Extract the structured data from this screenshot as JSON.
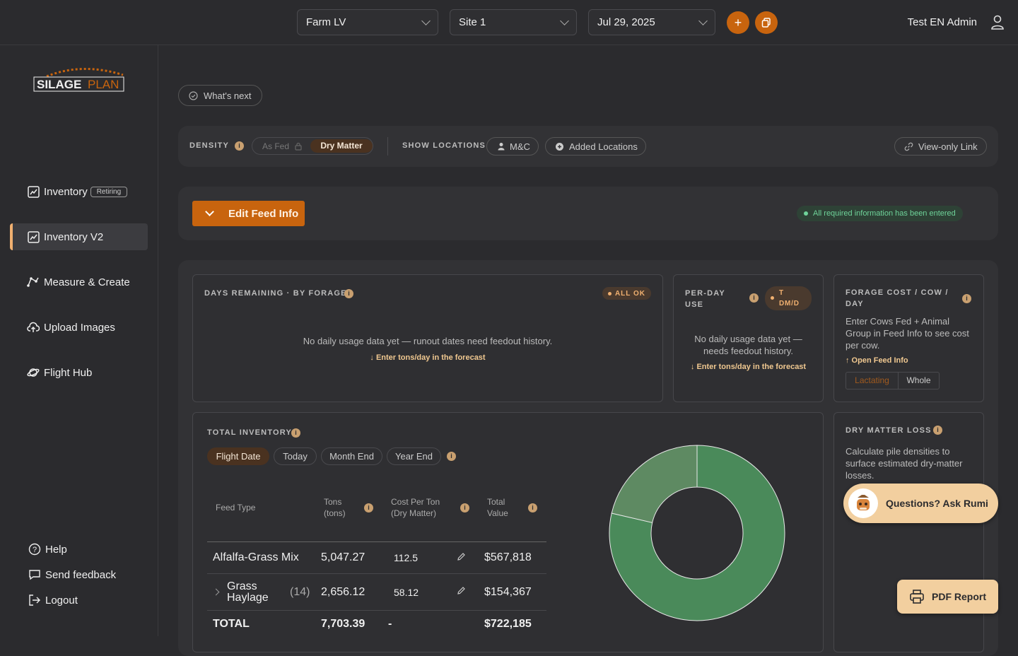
{
  "header": {
    "farm": "Farm LV",
    "site": "Site 1",
    "date": "Jul 29, 2025",
    "add": "+",
    "user": "Test EN Admin"
  },
  "brand": {
    "logo_text_a": "SILAGE",
    "logo_text_b": "PLAN",
    "accent": "#c8640e"
  },
  "sidebar": {
    "items": [
      {
        "label": "Inventory",
        "badge": "Retiring",
        "icon": "chart-icon"
      },
      {
        "label": "Inventory V2",
        "icon": "chart-icon"
      },
      {
        "label": "Measure & Create",
        "icon": "measure-icon"
      },
      {
        "label": "Upload Images",
        "icon": "cloud-upload-icon"
      },
      {
        "label": "Flight Hub",
        "icon": "planet-icon"
      }
    ],
    "footer": [
      {
        "label": "Help"
      },
      {
        "label": "Send feedback"
      },
      {
        "label": "Logout"
      }
    ]
  },
  "whats_next": "What's next",
  "toolbar": {
    "density": "DENSITY",
    "as_fed": "As Fed",
    "dry_matter": "Dry Matter",
    "show_locations": "SHOW LOCATIONS",
    "mc": "M&C",
    "added_locations": "Added Locations",
    "view_only": "View-only Link"
  },
  "feed": {
    "edit": "Edit Feed Info",
    "status": "All required information has been entered"
  },
  "days": {
    "title": "DAYS REMAINING · BY FORAGE",
    "status": "ALL OK",
    "empty": "No daily usage data yet — runout dates need feedout history.",
    "link": "↓ Enter tons/day in the forecast"
  },
  "perday": {
    "title_a": "PER-DAY",
    "title_b": "USE",
    "unit_a": "T",
    "unit_b": "DM/D",
    "empty_a": "No daily usage data yet —",
    "empty_b": "needs feedout history.",
    "link": "↓ Enter tons/day in the forecast"
  },
  "cost": {
    "title_a": "FORAGE COST / COW /",
    "title_b": "DAY",
    "body": "Enter Cows Fed + Animal Group in Feed Info to see cost per cow.",
    "link": "↑ Open Feed Info",
    "lactating": "Lactating",
    "whole": "Whole"
  },
  "total": {
    "title": "TOTAL INVENTORY",
    "tabs": [
      "Flight Date",
      "Today",
      "Month End",
      "Year End"
    ],
    "headers": {
      "feed": "Feed Type",
      "tons_a": "Tons",
      "tons_b": "(tons)",
      "cost_a": "Cost Per Ton",
      "cost_b": "(Dry Matter)",
      "value_a": "Total",
      "value_b": "Value"
    },
    "rows": [
      {
        "name": "Alfalfa-Grass Mix",
        "count": "",
        "tons": "5,047.27",
        "cost": "112.5",
        "value": "$567,818"
      },
      {
        "name_a": "Grass",
        "name_b": "Haylage",
        "count": "(14)",
        "tons": "2,656.12",
        "cost": "58.12",
        "value": "$154,367"
      }
    ],
    "total": {
      "label": "TOTAL",
      "tons": "7,703.39",
      "cost": "-",
      "value": "$722,185"
    }
  },
  "chart_data": {
    "type": "pie",
    "donut": true,
    "categories": [
      "Alfalfa-Grass Mix",
      "Grass Haylage"
    ],
    "values": [
      567818,
      154367
    ],
    "colors": [
      "#4a8a5a",
      "#5e8a62"
    ]
  },
  "dml": {
    "title": "DRY MATTER LOSS",
    "body": "Calculate pile densities to surface estimated dry-matter losses."
  },
  "rumi": "Questions? Ask Rumi",
  "pdf": "PDF Report"
}
